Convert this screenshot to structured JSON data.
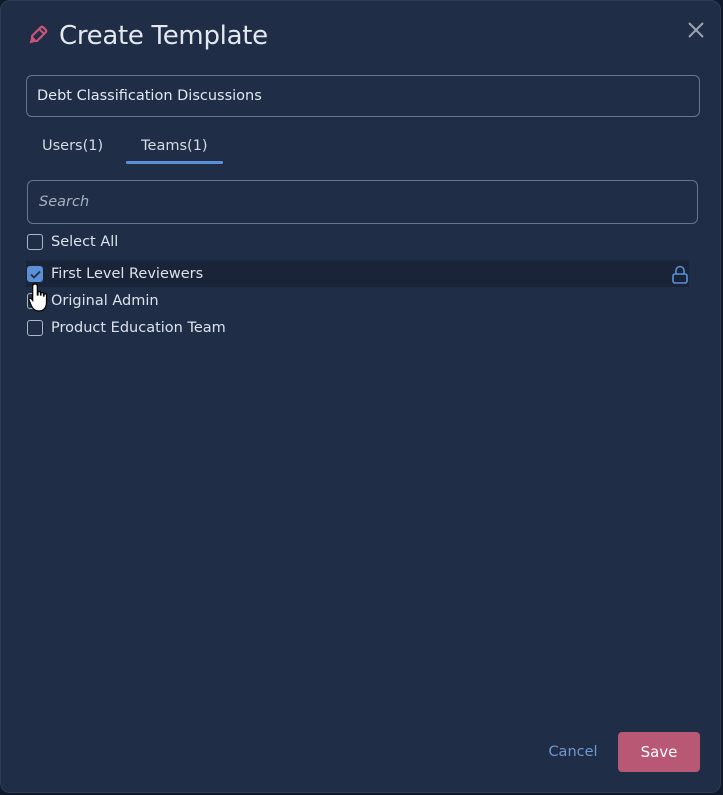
{
  "dialog": {
    "title": "Create Template",
    "icon": "pencil-icon",
    "close_icon": "close-icon"
  },
  "template_name": {
    "value": "Debt Classification Discussions"
  },
  "tabs": [
    {
      "label": "Users(1)",
      "active": false
    },
    {
      "label": "Teams(1)",
      "active": true
    }
  ],
  "search": {
    "placeholder": "Search",
    "value": ""
  },
  "select_all": {
    "label": "Select All",
    "checked": false
  },
  "teams": [
    {
      "label": "First Level Reviewers",
      "checked": true,
      "locked": true
    },
    {
      "label": "Original Admin",
      "checked": false,
      "locked": false
    },
    {
      "label": "Product Education Team",
      "checked": false,
      "locked": false
    }
  ],
  "footer": {
    "cancel_label": "Cancel",
    "save_label": "Save"
  },
  "colors": {
    "background": "#1f2d47",
    "accent": "#5b8fd6",
    "save": "#b85874",
    "pencil": "#c95478"
  }
}
